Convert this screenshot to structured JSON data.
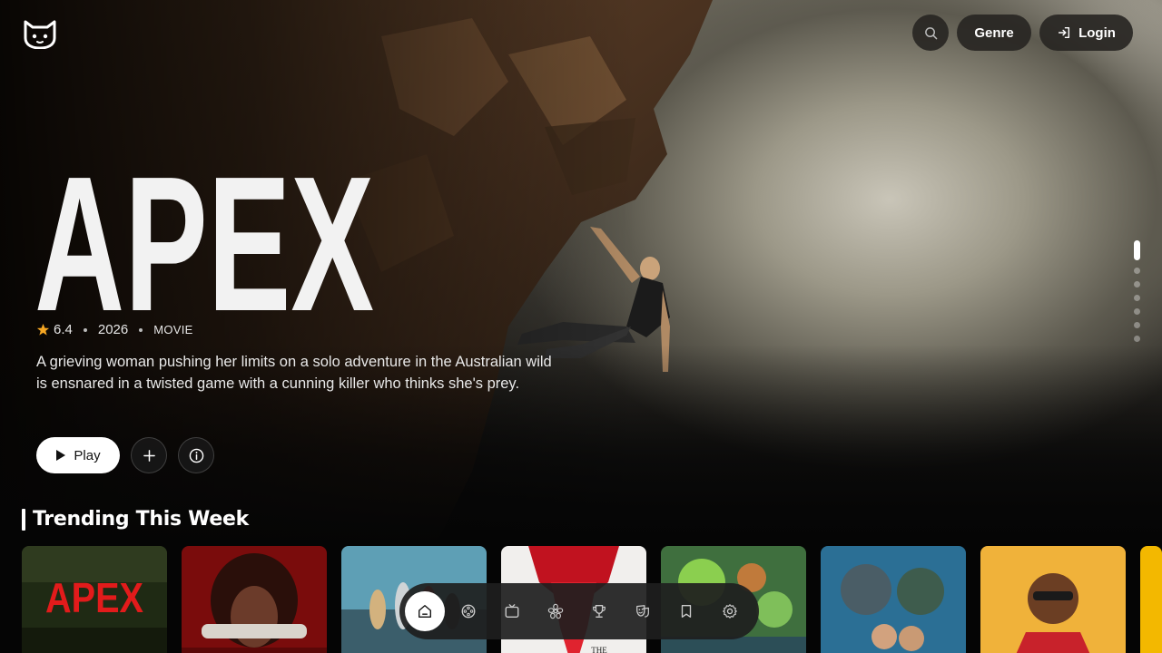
{
  "header": {
    "logo_icon": "cat-face-icon",
    "search_icon": "search-icon",
    "genre_label": "Genre",
    "login_label": "Login",
    "login_icon": "login-arrow-icon"
  },
  "hero": {
    "title": "APEX",
    "rating": "6.4",
    "year": "2026",
    "type": "MOVIE",
    "description": "A grieving woman pushing her limits on a solo adventure in the Australian wild is ensnared in a twisted game with a cunning killer who thinks she's prey.",
    "play_label": "Play",
    "add_icon": "plus-icon",
    "info_icon": "info-icon",
    "star_color": "#f5a623",
    "slide_count": 7,
    "active_slide": 1
  },
  "trending": {
    "title": "Trending This Week",
    "cards": [
      {
        "name": "apex-poster",
        "label": "APEX"
      },
      {
        "name": "poster-2",
        "label": ""
      },
      {
        "name": "poster-3",
        "label": ""
      },
      {
        "name": "poster-4",
        "label": "THE"
      },
      {
        "name": "poster-5",
        "label": ""
      },
      {
        "name": "poster-6",
        "label": ""
      },
      {
        "name": "poster-7",
        "label": ""
      }
    ]
  },
  "dock": {
    "items": [
      {
        "icon": "home-icon",
        "active": true
      },
      {
        "icon": "film-reel-icon",
        "active": false
      },
      {
        "icon": "tv-icon",
        "active": false
      },
      {
        "icon": "flower-icon",
        "active": false
      },
      {
        "icon": "trophy-icon",
        "active": false
      },
      {
        "icon": "theater-masks-icon",
        "active": false
      },
      {
        "icon": "bookmark-icon",
        "active": false
      },
      {
        "icon": "settings-icon",
        "active": false
      }
    ]
  }
}
